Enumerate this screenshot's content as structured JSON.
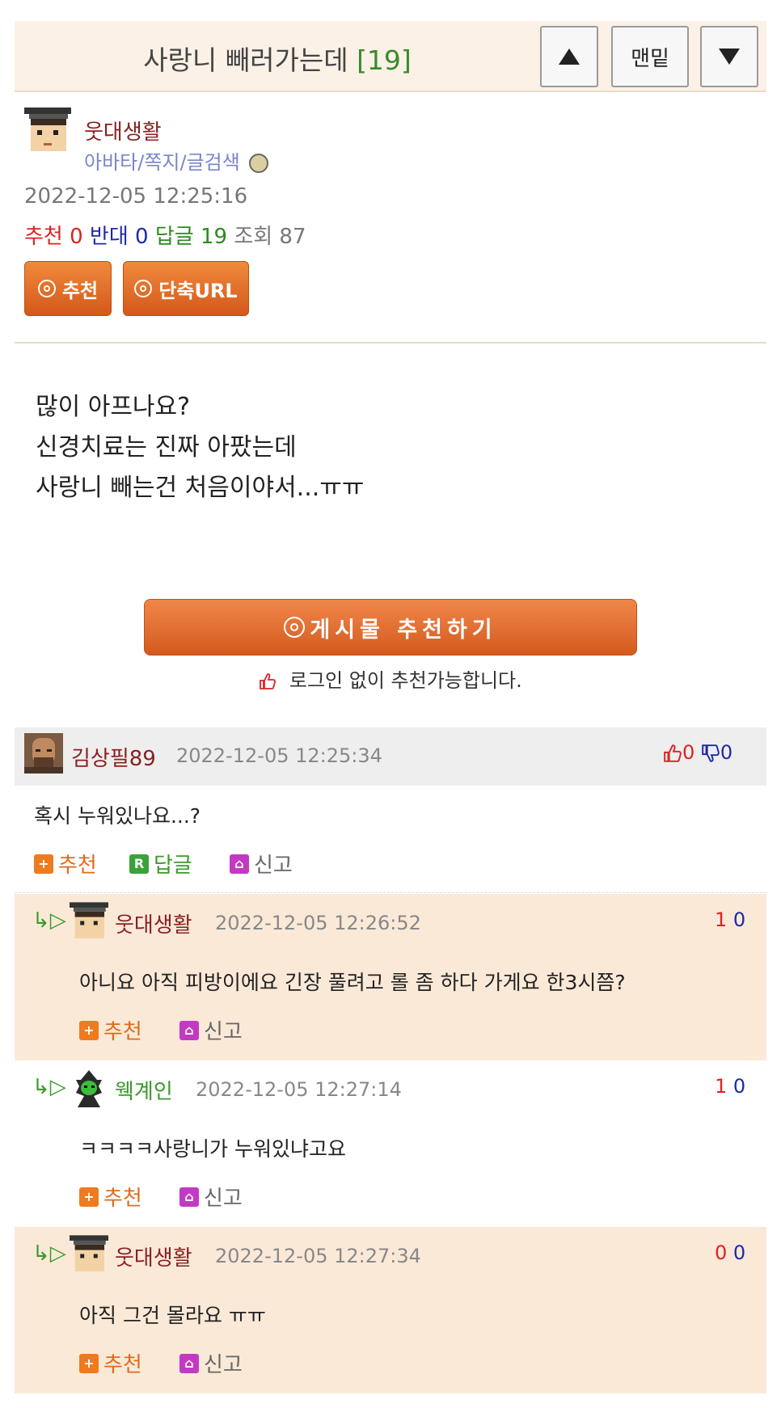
{
  "header": {
    "title": "사랑니 빼러가는데",
    "count": "[19]",
    "bottom_label": "맨밑"
  },
  "post": {
    "author": "웃대생활",
    "author_links": "아바타/쪽지/글검색",
    "date": "2022-12-05 12:25:16",
    "stats": {
      "rec_label": "추천",
      "rec_value": "0",
      "oppose_label": "반대",
      "oppose_value": "0",
      "reply_label": "답글",
      "reply_value": "19",
      "view_label": "조회",
      "view_value": "87"
    },
    "buttons": {
      "recommend": "추천",
      "short_url": "단축URL"
    },
    "body": [
      "많이 아프나요?",
      "신경치료는 진짜 아팠는데",
      "사랑니 빼는건 처음이야서...ㅠㅠ"
    ],
    "big_recommend": "게시물 추천하기",
    "login_note": "로그인 없이 추천가능합니다."
  },
  "comments": [
    {
      "author": "김상필89",
      "date": "2022-12-05 12:25:34",
      "up": "0",
      "down": "0",
      "text": "혹시 누워있나요...?",
      "actions": {
        "recommend": "추천",
        "reply": "답글",
        "report": "신고"
      }
    },
    {
      "author": "웃대생활",
      "date": "2022-12-05 12:26:52",
      "up": "1",
      "down": "0",
      "text": "아니요 아직 피방이에요 긴장 풀려고 롤 좀 하다 가게요 한3시쯤?",
      "actions": {
        "recommend": "추천",
        "report": "신고"
      }
    },
    {
      "author": "웩계인",
      "date": "2022-12-05 12:27:14",
      "up": "1",
      "down": "0",
      "text": "ㅋㅋㅋㅋ사랑니가 누워있냐고요",
      "actions": {
        "recommend": "추천",
        "report": "신고"
      }
    },
    {
      "author": "웃대생활",
      "date": "2022-12-05 12:27:34",
      "up": "0",
      "down": "0",
      "text": "아직 그건 몰라요 ㅠㅠ",
      "actions": {
        "recommend": "추천",
        "report": "신고"
      }
    }
  ],
  "colors": {
    "accent_orange": "#e06a1a",
    "header_bg": "#fbf1e6",
    "reply_bg": "#fbe9d8"
  },
  "reply_arrow": "↳▷"
}
